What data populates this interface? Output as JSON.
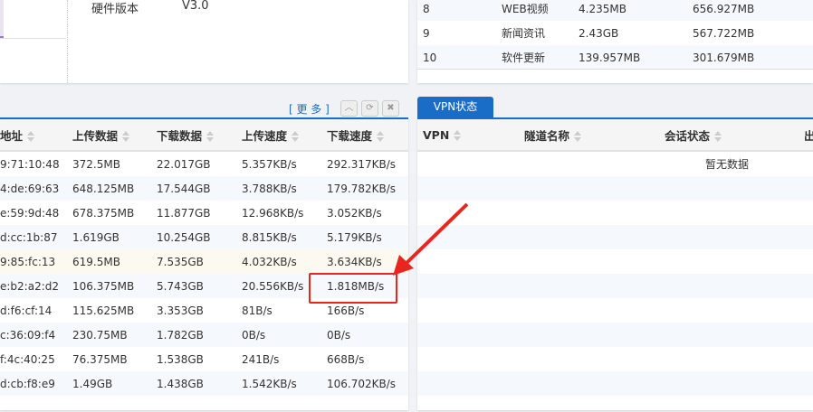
{
  "device_info": {
    "label": "硬件版本",
    "value": "V3.0"
  },
  "app_table": {
    "rows": [
      {
        "rank": "8",
        "app": "WEB视频",
        "up": "4.235MB",
        "down": "656.927MB"
      },
      {
        "rank": "9",
        "app": "新闻资讯",
        "up": "2.43GB",
        "down": "567.722MB"
      },
      {
        "rank": "10",
        "app": "软件更新",
        "up": "139.957MB",
        "down": "301.679MB"
      }
    ]
  },
  "host_panel": {
    "more_label": "[ 更 多 ]",
    "columns": [
      "地址",
      "上传数据",
      "下载数据",
      "上传速度",
      "下载速度"
    ],
    "rows": [
      {
        "mac": "9:71:10:48",
        "up": "372.5MB",
        "down": "22.017GB",
        "ups": "5.357KB/s",
        "downs": "292.317KB/s"
      },
      {
        "mac": "4:de:69:63",
        "up": "648.125MB",
        "down": "17.544GB",
        "ups": "3.788KB/s",
        "downs": "179.782KB/s"
      },
      {
        "mac": "e:59:9d:48",
        "up": "678.375MB",
        "down": "11.877GB",
        "ups": "12.968KB/s",
        "downs": "3.052KB/s"
      },
      {
        "mac": "d:cc:1b:87",
        "up": "1.619GB",
        "down": "10.254GB",
        "ups": "8.815KB/s",
        "downs": "5.179KB/s"
      },
      {
        "mac": "9:85:fc:13",
        "up": "619.5MB",
        "down": "7.535GB",
        "ups": "4.032KB/s",
        "downs": "3.634KB/s"
      },
      {
        "mac": "e:b2:a2:d2",
        "up": "106.375MB",
        "down": "5.743GB",
        "ups": "20.556KB/s",
        "downs": "1.818MB/s"
      },
      {
        "mac": "d:f6:cf:14",
        "up": "115.625MB",
        "down": "3.353GB",
        "ups": "81B/s",
        "downs": "166B/s"
      },
      {
        "mac": "c:36:09:f4",
        "up": "230.75MB",
        "down": "1.782GB",
        "ups": "0B/s",
        "downs": "0B/s"
      },
      {
        "mac": "f:4c:40:25",
        "up": "76.375MB",
        "down": "1.538GB",
        "ups": "241B/s",
        "downs": "668B/s"
      },
      {
        "mac": "d:cb:f8:e9",
        "up": "1.49GB",
        "down": "1.438GB",
        "ups": "1.542KB/s",
        "downs": "106.702KB/s"
      }
    ]
  },
  "vpn_panel": {
    "tab": "VPN状态",
    "columns": [
      "VPN",
      "隧道名称",
      "会话状态",
      "出"
    ],
    "empty": "暂无数据"
  },
  "colors": {
    "accent": "#1a6dc7",
    "annotation": "#e8261f"
  }
}
